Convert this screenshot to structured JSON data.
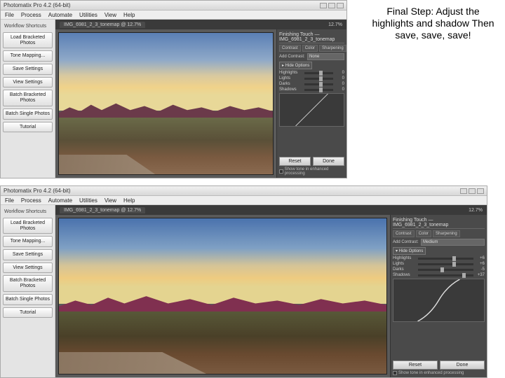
{
  "annotation": "Final Step: Adjust the highlights and shadow Then save, save, save!",
  "app1": {
    "title": "Photomatix Pro 4.2 (64-bit)",
    "menus": [
      "File",
      "Process",
      "Automate",
      "Utilities",
      "View",
      "Help"
    ],
    "tab": "IMG_6981_2_3_tonemap @ 12.7%",
    "zoom": "12.7%",
    "sidebarHeader": "Workflow Shortcuts",
    "sidebar": [
      "Load Bracketed Photos",
      "Tone Mapping...",
      "Save Settings",
      "View Settings",
      "Batch Bracketed Photos",
      "Batch Single Photos",
      "Tutorial"
    ],
    "panelTitle": "Finishing Touch — IMG_6981_2_3_tonemap",
    "tabs": [
      "Contrast",
      "Color",
      "Sharpening"
    ],
    "contrastLabel": "Add Contrast:",
    "contrastValue": "None",
    "hideBtn": "▸ Hide Options",
    "sliders": [
      {
        "label": "Highlights",
        "value": "0",
        "pos": 50
      },
      {
        "label": "Lights",
        "value": "0",
        "pos": 50
      },
      {
        "label": "Darks",
        "value": "0",
        "pos": 50
      },
      {
        "label": "Shadows",
        "value": "0",
        "pos": 50
      }
    ],
    "buttons": {
      "reset": "Reset",
      "done": "Done"
    },
    "checkbox": "Show tone in enhanced processing"
  },
  "app2": {
    "title": "Photomatix Pro 4.2 (64-bit)",
    "menus": [
      "File",
      "Process",
      "Automate",
      "Utilities",
      "View",
      "Help"
    ],
    "tab": "IMG_6981_2_3_tonemap @ 12.7%",
    "zoom": "12.7%",
    "sidebarHeader": "Workflow Shortcuts",
    "sidebar": [
      "Load Bracketed Photos",
      "Tone Mapping...",
      "Save Settings",
      "View Settings",
      "Batch Bracketed Photos",
      "Batch Single Photos",
      "Tutorial"
    ],
    "panelTitle": "Finishing Touch — IMG_6981_2_3_tonemap",
    "tabs": [
      "Contrast",
      "Color",
      "Sharpening"
    ],
    "contrastLabel": "Add Contrast:",
    "contrastValue": "Medium",
    "hideBtn": "▾ Hide Options",
    "sliders": [
      {
        "label": "Highlights",
        "value": "+6",
        "pos": 62
      },
      {
        "label": "Lights",
        "value": "+6",
        "pos": 62
      },
      {
        "label": "Darks",
        "value": "-5",
        "pos": 40
      },
      {
        "label": "Shadows",
        "value": "+37",
        "pos": 80
      }
    ],
    "buttons": {
      "reset": "Reset",
      "done": "Done"
    },
    "checkbox": "Show tone in enhanced processing"
  }
}
